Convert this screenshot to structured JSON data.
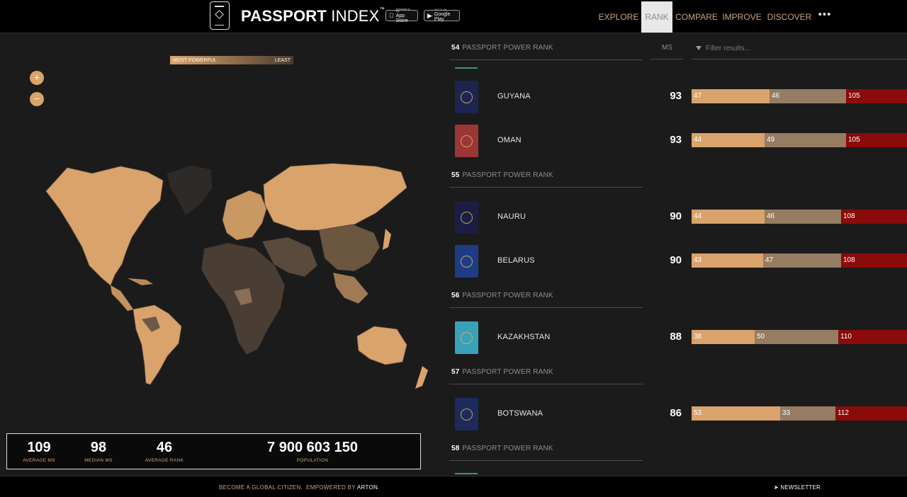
{
  "header": {
    "brand_bold": "PASSPORT",
    "brand_thin": " INDEX",
    "brand_tm": "™",
    "app_store_small": "Download on the",
    "app_store_big": "App Store",
    "google_play_small": "GET IT ON",
    "google_play_big": "Google Play",
    "nav": [
      {
        "label": "EXPLORE",
        "active": false
      },
      {
        "label": "RANK",
        "active": true
      },
      {
        "label": "COMPARE",
        "active": false
      },
      {
        "label": "IMPROVE",
        "active": false
      },
      {
        "label": "DISCOVER",
        "active": false
      }
    ],
    "more_label": "•••"
  },
  "map": {
    "legend_most": "MOST POWERFUL",
    "legend_least": "LEAST",
    "zoom_in": "+",
    "zoom_out": "−"
  },
  "stats": {
    "average_ms": {
      "value": "109",
      "label": "AVERAGE MS"
    },
    "median_ms": {
      "value": "98",
      "label": "MEDIAN MS"
    },
    "average_rank": {
      "value": "46",
      "label": "AVERAGE RANK"
    },
    "population": {
      "value": "7 900 603 150",
      "label": "POPULATION"
    }
  },
  "ranking": {
    "rank_suffix": "PASSPORT POWER RANK",
    "ms_label": "MS",
    "filter_placeholder": "Filter results...",
    "groups": [
      {
        "rank": "54",
        "countries": [
          {
            "name": "GUYANA",
            "ms": "93",
            "a": 47,
            "b": 46,
            "c": 105,
            "color": "#1d2450"
          },
          {
            "name": "OMAN",
            "ms": "93",
            "a": 44,
            "b": 49,
            "c": 105,
            "color": "#9c3636"
          }
        ]
      },
      {
        "rank": "55",
        "countries": [
          {
            "name": "NAURU",
            "ms": "90",
            "a": 44,
            "b": 46,
            "c": 108,
            "color": "#1b1d44"
          },
          {
            "name": "BELARUS",
            "ms": "90",
            "a": 43,
            "b": 47,
            "c": 108,
            "color": "#1e3c86"
          }
        ]
      },
      {
        "rank": "56",
        "countries": [
          {
            "name": "KAZAKHSTAN",
            "ms": "88",
            "a": 38,
            "b": 50,
            "c": 110,
            "color": "#3aa2b8"
          }
        ]
      },
      {
        "rank": "57",
        "countries": [
          {
            "name": "BOTSWANA",
            "ms": "86",
            "a": 53,
            "b": 33,
            "c": 112,
            "color": "#1c2a5c"
          }
        ]
      },
      {
        "rank": "58",
        "countries": []
      }
    ]
  },
  "footer": {
    "citizen": "BECOME A GLOBAL CITIZEN.",
    "empowered": "EMPOWERED BY",
    "arton": "ARTON.",
    "newsletter": "NEWSLETTER"
  },
  "colors": {
    "accent": "#d9a36b",
    "visa_free": "#d9a36b",
    "visa_on_arrival": "#957c63",
    "visa_required": "#8b0a0a"
  }
}
